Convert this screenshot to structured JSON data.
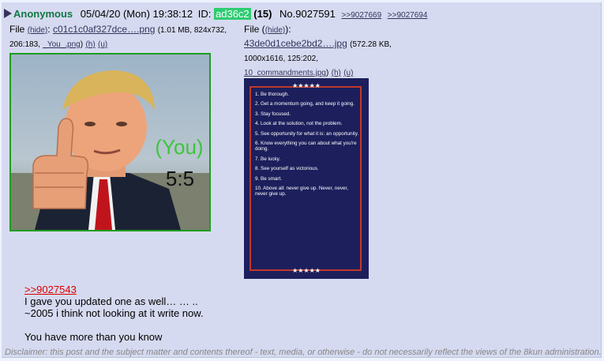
{
  "post": {
    "name": "Anonymous",
    "date": "05/04/20 (Mon) 19:38:12",
    "id_label": "ID:",
    "id": "ad36c2",
    "post_count": "(15)",
    "number": "No.9027591",
    "backlinks": [
      ">>9027669",
      ">>9027694"
    ],
    "colors": {
      "name": "#117743",
      "id_bg": "#2ecc71",
      "quote": "#dd0000",
      "post_bg": "#d6daf0"
    }
  },
  "files": [
    {
      "label": "File",
      "hide": "(hide)",
      "filename": "c01c1c0af327dce….png",
      "meta": "(1.01 MB, 824x732, 206:183,",
      "orig": "_You_.png",
      "h": "(h)",
      "u": "(u)",
      "image_text": {
        "you": "(You)",
        "score": "5:5"
      }
    },
    {
      "label": "File",
      "hide": "(hide)",
      "filename": "43de0d1cebe2bd2….jpg",
      "meta": "(572.28 KB, 1000x1616, 125:202,",
      "orig": "10_commandments.jpg",
      "h": "(h)",
      "u": "(u)",
      "stars": "★★★★★",
      "rules": [
        "1. Be thorough.",
        "2. Get a momentum going, and keep it going.",
        "3. Stay focused.",
        "4. Look at the solution, not the problem.",
        "5. See opportunity for what it is: an opportunity.",
        "6. Know everything you can about what you're doing.",
        "7. Be lucky.",
        "8. See yourself as victorious.",
        "9. Be smart.",
        "10. Above all: never give up. Never, never, never give up."
      ]
    }
  ],
  "body": {
    "quote": ">>9027543",
    "lines": [
      "I gave you updated one as well… … ..",
      "~2005 i think not looking at it write now.",
      "",
      "You have more than you know"
    ]
  },
  "disclaimer": "Disclaimer: this post and the subject matter and contents thereof - text, media, or otherwise - do not necessarily reflect the views of the 8kun administration."
}
